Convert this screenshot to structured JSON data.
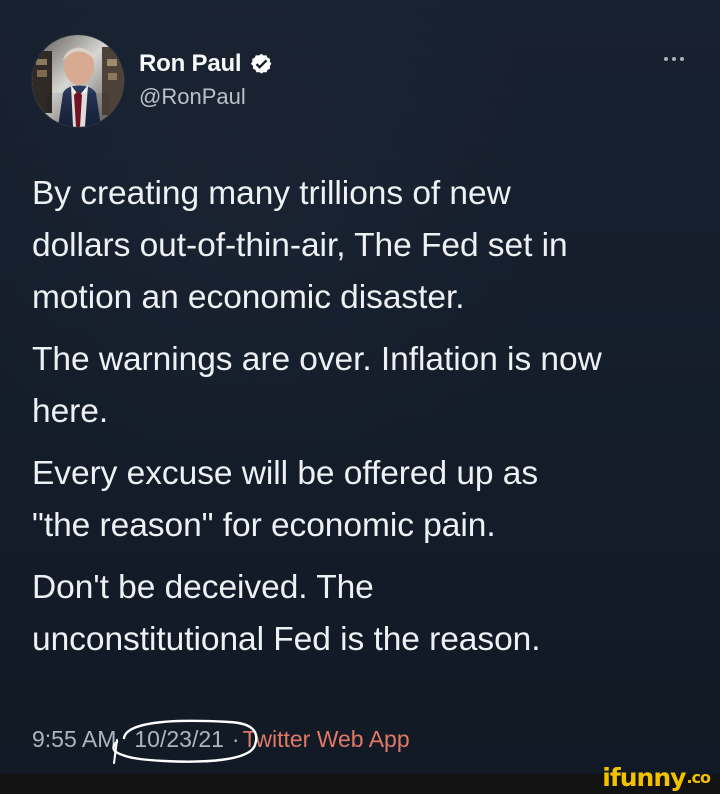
{
  "profile": {
    "display_name": "Ron Paul",
    "handle": "@RonPaul",
    "avatar_name": "profile-photo"
  },
  "tweet": {
    "paragraphs": [
      "By creating many trillions of new\ndollars out-of-thin-air, The Fed set in\nmotion an economic disaster.",
      "The warnings are over. Inflation is now\nhere.",
      "Every excuse will be offered up as\n\"the reason\" for economic pain.",
      "Don't be deceived. The\nunconstitutional Fed is the reason."
    ]
  },
  "meta": {
    "time": "9:55 AM",
    "separator": "·",
    "date": "10/23/21",
    "source": "Twitter Web App"
  },
  "watermark": {
    "brand": "ifunny",
    "suffix": ".co"
  },
  "colors": {
    "background": "#151d28",
    "text": "#eef1f4",
    "secondary_text": "#aeb5be",
    "source": "#e07865",
    "verified": "#ffffff",
    "watermark": "#f2c200"
  },
  "icons": {
    "verified": "verified-icon",
    "more": "more-icon"
  }
}
